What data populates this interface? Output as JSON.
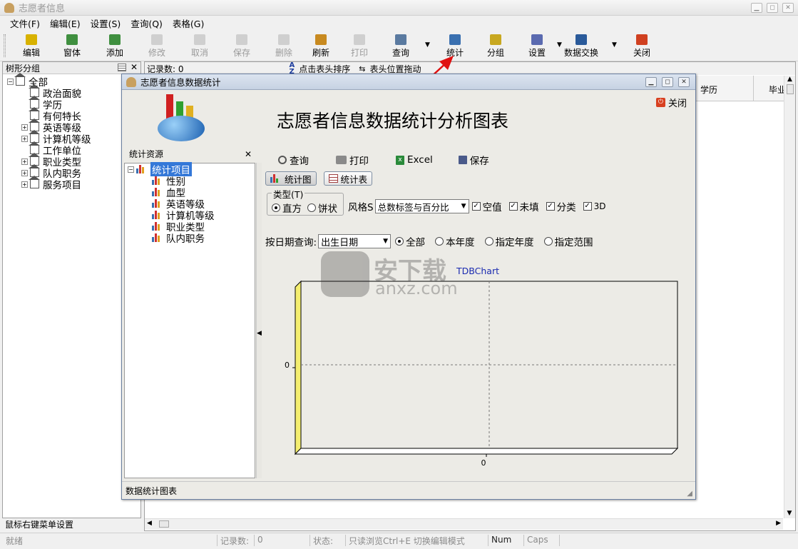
{
  "window": {
    "title": "志愿者信息"
  },
  "menu": [
    "文件(F)",
    "编辑(E)",
    "设置(S)",
    "查询(Q)",
    "表格(G)"
  ],
  "toolbar": {
    "items": [
      {
        "label": "编辑",
        "disabled": false,
        "color": "#d8b200"
      },
      {
        "label": "窗体",
        "disabled": false,
        "color": "#3f8f3f"
      },
      {
        "label": "添加",
        "disabled": false,
        "color": "#3f8f3f"
      },
      {
        "label": "修改",
        "disabled": true,
        "color": "#c0a080"
      },
      {
        "label": "取消",
        "disabled": true,
        "color": "#8ab0d8"
      },
      {
        "label": "保存",
        "disabled": true,
        "color": "#8aa0c8"
      },
      {
        "label": "删除",
        "disabled": true,
        "color": "#d8a8a8"
      },
      {
        "label": "刷新",
        "disabled": false,
        "color": "#c88a20"
      },
      {
        "label": "打印",
        "disabled": true,
        "color": "#9a9a9a"
      },
      {
        "label": "查询",
        "disabled": false,
        "color": "#5a7aa0"
      },
      {
        "label": "统计",
        "disabled": false,
        "color": "#3a70b0"
      },
      {
        "label": "分组",
        "disabled": false,
        "color": "#c8a820"
      },
      {
        "label": "设置",
        "disabled": false,
        "color": "#5a6ab0"
      },
      {
        "label": "数据交换",
        "disabled": false,
        "color": "#2a5a9a"
      },
      {
        "label": "关闭",
        "disabled": false,
        "color": "#d04020"
      }
    ]
  },
  "left_panel": {
    "title": "树形分组",
    "tree": [
      {
        "label": "全部",
        "level": 0,
        "expander": "−"
      },
      {
        "label": "政治面貌",
        "level": 1,
        "expander": ""
      },
      {
        "label": "学历",
        "level": 1,
        "expander": ""
      },
      {
        "label": "有何特长",
        "level": 1,
        "expander": ""
      },
      {
        "label": "英语等级",
        "level": 1,
        "expander": "+"
      },
      {
        "label": "计算机等级",
        "level": 1,
        "expander": "+"
      },
      {
        "label": "工作单位",
        "level": 1,
        "expander": ""
      },
      {
        "label": "职业类型",
        "level": 1,
        "expander": "+"
      },
      {
        "label": "队内职务",
        "level": 1,
        "expander": "+"
      },
      {
        "label": "服务项目",
        "level": 1,
        "expander": "+"
      }
    ],
    "footer": "鼠标右键菜单设置"
  },
  "right_bar": {
    "record_count": "记录数: 0",
    "sort_hint": "点击表头排序",
    "drag_hint": "表头位置拖动"
  },
  "grid_headers": [
    "学历",
    "毕业"
  ],
  "status_bar": {
    "ready": "就绪",
    "records_label": "记录数:",
    "records_value": "0",
    "state_label": "状态:",
    "state_value": "只读浏览Ctrl+E 切换编辑模式",
    "num": "Num",
    "caps": "Caps"
  },
  "dialog": {
    "title": "志愿者信息数据统计",
    "close_label": "关闭",
    "heading": "志愿者信息数据统计分析图表",
    "resource_title": "统计资源",
    "stat_tree": {
      "root": "统计项目",
      "items": [
        "性别",
        "血型",
        "英语等级",
        "计算机等级",
        "职业类型",
        "队内职务"
      ]
    },
    "actions": {
      "query": "查询",
      "print": "打印",
      "excel": "Excel",
      "save": "保存"
    },
    "tabs": {
      "chart": "统计图",
      "table": "统计表"
    },
    "type_group": {
      "label": "类型(T)",
      "bar": "直方",
      "pie": "饼状",
      "selected": "bar"
    },
    "style": {
      "label": "风格S",
      "value": "总数标签与百分比"
    },
    "checks": [
      {
        "label": "空值",
        "checked": true
      },
      {
        "label": "未填",
        "checked": true
      },
      {
        "label": "分类",
        "checked": true
      },
      {
        "label": "3D",
        "checked": true
      }
    ],
    "date_query": {
      "label": "按日期查询:",
      "field": "出生日期",
      "options": [
        {
          "label": "全部",
          "selected": true
        },
        {
          "label": "本年度",
          "selected": false
        },
        {
          "label": "指定年度",
          "selected": false
        },
        {
          "label": "指定范围",
          "selected": false
        }
      ]
    },
    "footer": "数据统计图表"
  },
  "chart_data": {
    "type": "bar",
    "title": "TDBChart",
    "categories": [],
    "values": [],
    "xlabel": "",
    "ylabel": "",
    "x_tick": "0",
    "y_tick": "0",
    "grid": true,
    "three_d": true
  },
  "watermark": {
    "cn": "安下载",
    "en": "anxz.com"
  },
  "colors": {
    "dialog_title": "#c6d2e2",
    "selection": "#3478d8",
    "wall": "#f4ee70"
  }
}
